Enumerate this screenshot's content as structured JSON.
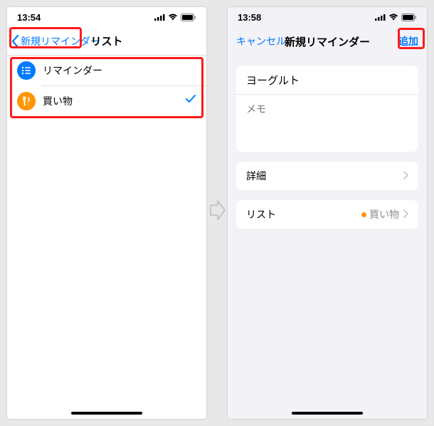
{
  "left": {
    "time": "13:54",
    "nav": {
      "back": "新規リマインダー",
      "title": "リスト"
    },
    "rows": [
      {
        "label": "リマインダー",
        "iconColor": "blue",
        "icon": "list-bullet",
        "checked": false
      },
      {
        "label": "買い物",
        "iconColor": "orange",
        "icon": "utensils",
        "checked": true
      }
    ]
  },
  "right": {
    "time": "13:58",
    "nav": {
      "cancel": "キャンセル",
      "title": "新規リマインダー",
      "action": "追加"
    },
    "form": {
      "title_value": "ヨーグルト",
      "memo_placeholder": "メモ"
    },
    "details_label": "詳細",
    "list_row": {
      "label": "リスト",
      "value": "買い物"
    }
  }
}
